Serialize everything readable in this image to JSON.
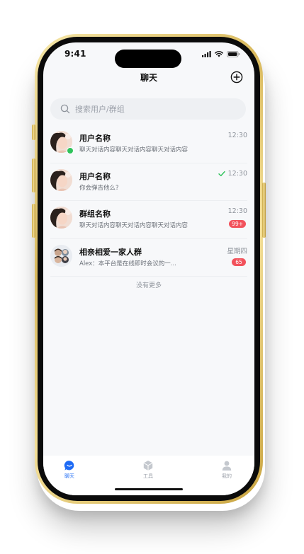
{
  "status_bar": {
    "time": "9:41"
  },
  "header": {
    "title": "聊天",
    "add_icon": "plus-circle-icon"
  },
  "search": {
    "placeholder": "搜索用户/群组"
  },
  "chats": [
    {
      "name": "用户名称",
      "preview": "聊天对话内容聊天对话内容聊天对话内容",
      "time": "12:30",
      "online": true,
      "read": false,
      "badge": ""
    },
    {
      "name": "用户名称",
      "preview": "你会弹吉他么?",
      "time": "12:30",
      "online": false,
      "read": true,
      "badge": ""
    },
    {
      "name": "群组名称",
      "preview": "聊天对话内容聊天对话内容聊天对话内容",
      "time": "12:30",
      "online": false,
      "read": false,
      "badge": "99+"
    },
    {
      "name": "相亲相爱一家人群",
      "preview": "Alex：本平台是在线即时会议的一...",
      "time": "星期四",
      "online": false,
      "read": false,
      "badge": "65"
    }
  ],
  "list_footer": "没有更多",
  "tabs": [
    {
      "label": "聊天",
      "icon": "chat-bubble-icon",
      "active": true
    },
    {
      "label": "工具",
      "icon": "cube-icon",
      "active": false
    },
    {
      "label": "我的",
      "icon": "person-icon",
      "active": false
    }
  ],
  "colors": {
    "accent": "#1e6bf5",
    "badge": "#f2525c",
    "online": "#2fc25b",
    "read_check": "#2fc25b",
    "frame_gold": "#d9b95d"
  }
}
